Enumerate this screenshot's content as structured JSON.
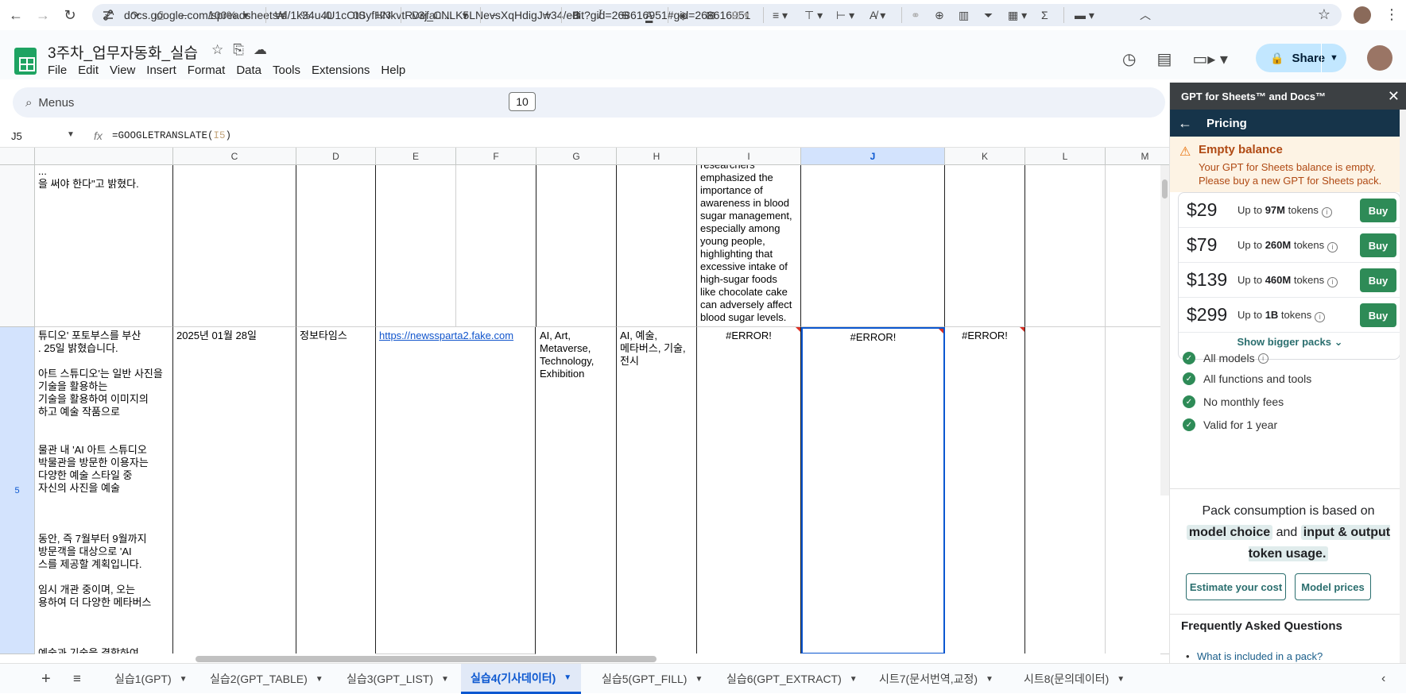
{
  "browser": {
    "url": "docs.google.com/spreadsheets/d/1k34u4U1cOtSyfHNkvtRv3j_CNLK5LNevsXqHdigJw34/edit?gid=268616951#gid=268616951"
  },
  "doc": {
    "title": "3주차_업무자동화_실습",
    "menus": [
      "File",
      "Edit",
      "View",
      "Insert",
      "Format",
      "Data",
      "Tools",
      "Extensions",
      "Help"
    ],
    "share_label": "Share"
  },
  "toolbar": {
    "menus_label": "Menus",
    "zoom": "100%",
    "currency": "₩",
    "percent": "%",
    "dec_decrease": ".0",
    "dec_increase": ".00",
    "number_format": "123",
    "font": "Defaul...",
    "font_size": "10"
  },
  "formula_bar": {
    "cell_ref": "J5",
    "formula_prefix": "=GOOGLETRANSLATE(",
    "formula_ref": "I5",
    "formula_suffix": ")"
  },
  "columns": [
    "C",
    "D",
    "E",
    "F",
    "G",
    "H",
    "I",
    "J",
    "K",
    "L",
    "M"
  ],
  "selected_column": "J",
  "rows": {
    "row5_header": "5",
    "b_prev_text": "...\n을 써야 한다\"고 밝혔다.",
    "i_prev_text": "sugar levels. The\nresearchers\nemphasized the\nimportance of\nawareness in blood\nsugar management,\nespecially among\nyoung people,\nhighlighting that\nexcessive intake of\nhigh-sugar foods\nlike chocolate cake\ncan adversely affect\nblood sugar levels.",
    "b5_text": "튜디오' 포토부스를 부산\n. 25일 밝혔습니다.\n\n아트 스튜디오'는 일반 사진을\n기술을 활용하는\n기술을 활용하여 이미지의\n하고 예술 작품으로\n\n\n물관 내 'AI 아트 스튜디오\n박물관을 방문한 이용자는\n다양한 예술 스타일 중\n자신의 사진을 예술\n\n\n\n동안, 즉 7월부터 9월까지\n방문객을 대상으로 'AI\n스를 제공할 계획입니다.\n\n임시 개관 중이며, 오는\n용하여 더 다양한 메타버스\n\n\n\n예술과 기술을 결합하여\n 흥미로운 경험을",
    "c5": "2025년 01월 28일",
    "d5": "정보타임스",
    "e5": "https://newssparta2.fake.com",
    "g5": "AI, Art,\nMetaverse,\nTechnology,\nExhibition",
    "h5": "AI, 예술,\n메타버스, 기술,\n전시",
    "i5": "#ERROR!",
    "j5": "#ERROR!",
    "k5": "#ERROR!"
  },
  "sheet_tabs": [
    {
      "label": "실습1(GPT)"
    },
    {
      "label": "실습2(GPT_TABLE)"
    },
    {
      "label": "실습3(GPT_LIST)"
    },
    {
      "label": "실습4(기사데이터)",
      "active": true
    },
    {
      "label": "실습5(GPT_FILL)"
    },
    {
      "label": "실습6(GPT_EXTRACT)"
    },
    {
      "label": "시트7(문서번역,교정)"
    },
    {
      "label": "시트8(문의데이터)"
    }
  ],
  "panel": {
    "header": "GPT for Sheets™ and Docs™",
    "nav_title": "Pricing",
    "warning_title": "Empty balance",
    "warning_text": "Your GPT for Sheets balance is empty. Please buy a new GPT for Sheets pack.",
    "packs": [
      {
        "price": "$29",
        "prefix": "Up to ",
        "tokens": "97M",
        "suffix": " tokens",
        "buy": "Buy"
      },
      {
        "price": "$79",
        "prefix": "Up to ",
        "tokens": "260M",
        "suffix": " tokens",
        "buy": "Buy"
      },
      {
        "price": "$139",
        "prefix": "Up to ",
        "tokens": "460M",
        "suffix": " tokens",
        "buy": "Buy"
      },
      {
        "price": "$299",
        "prefix": "Up to ",
        "tokens": "1B",
        "suffix": " tokens",
        "buy": "Buy"
      }
    ],
    "show_bigger": "Show bigger packs",
    "features": [
      "All models",
      "All functions and tools",
      "No monthly fees",
      "Valid for 1 year"
    ],
    "consumption_prefix": "Pack consumption is based on",
    "consumption_hl1": "model choice",
    "consumption_and": "and",
    "consumption_hl2": "input & output token usage.",
    "estimate_button": "Estimate your cost",
    "model_prices_button": "Model prices",
    "faq_title": "Frequently Asked Questions",
    "faq_item": "What is included in a pack?"
  },
  "colors": {
    "accent": "#0b57d0",
    "brand_green": "#1ea362",
    "buy_green": "#2e8b57",
    "error_red": "#d93025"
  }
}
